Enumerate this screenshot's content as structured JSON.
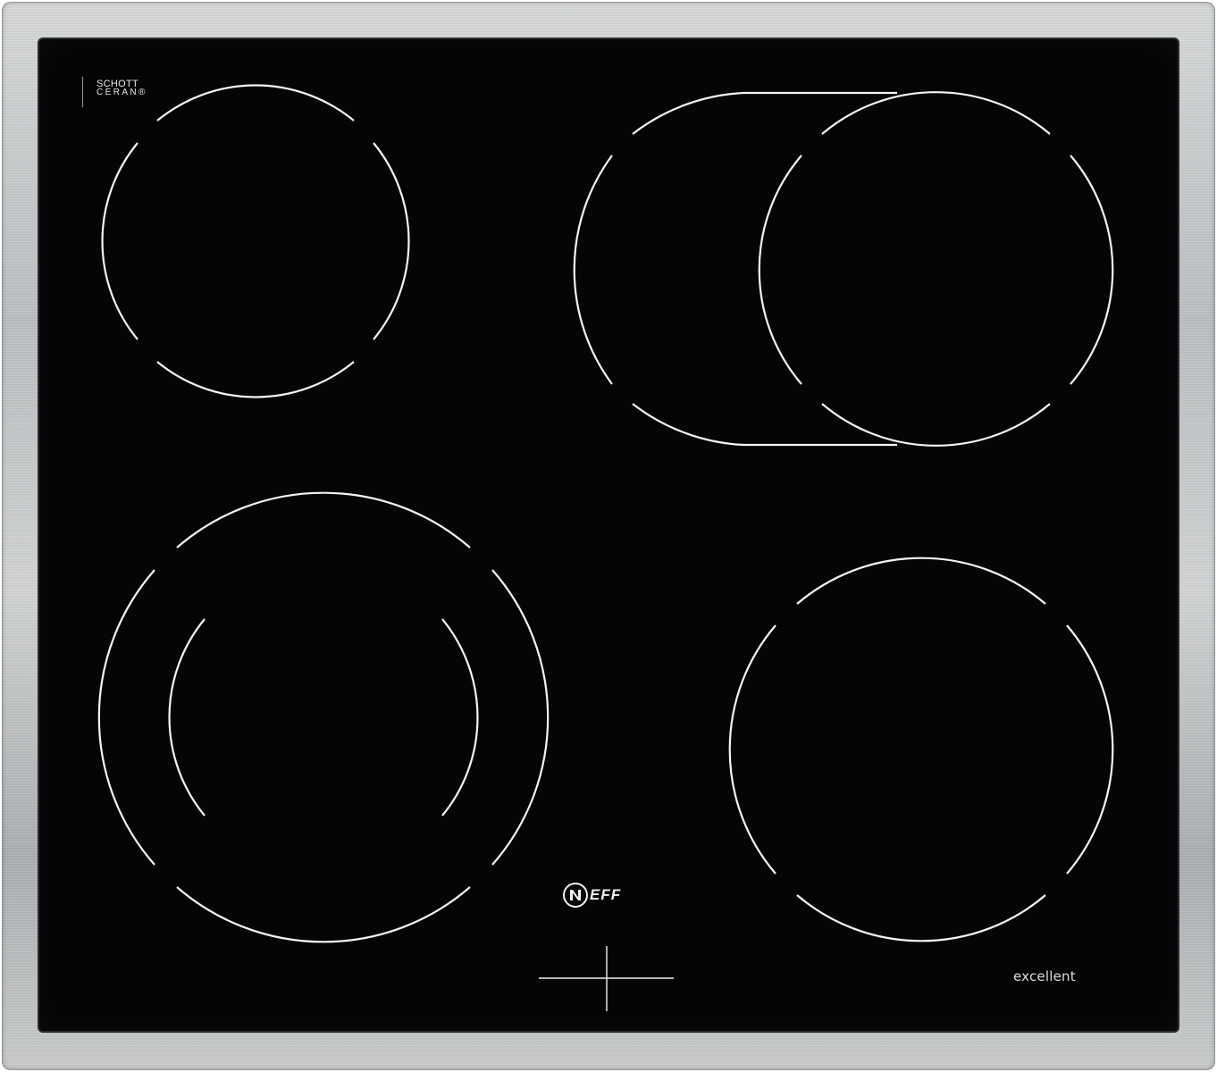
{
  "brand": {
    "glass_maker_line1": "SCHOTT",
    "glass_maker_line2": "CERAN®",
    "logo_text": "EFF",
    "series_label": "excellent"
  },
  "colors": {
    "glass": "#050507",
    "zone_lines": "#f4f4f4",
    "steel_frame": "#c4c6c7"
  },
  "icons": [
    "neff-logo-icon",
    "control-cross-icon"
  ]
}
